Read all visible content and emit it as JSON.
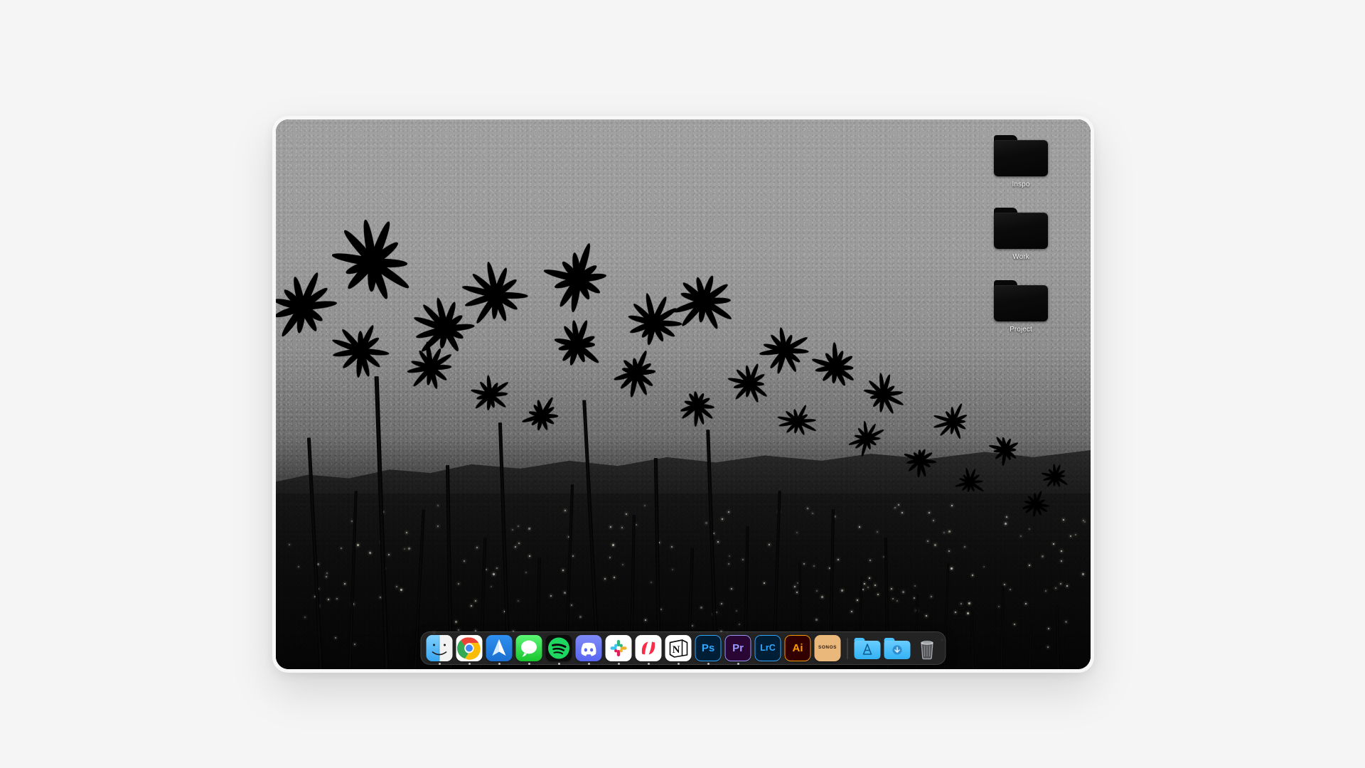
{
  "desktop": {
    "folders": [
      {
        "label": "Inspo",
        "icon": "folder-icon"
      },
      {
        "label": "Work",
        "icon": "folder-icon"
      },
      {
        "label": "Project",
        "icon": "folder-icon"
      }
    ]
  },
  "dock": {
    "items": [
      {
        "name": "finder",
        "label": "Finder",
        "icon": "finder-icon",
        "running": true
      },
      {
        "name": "chrome",
        "label": "Google Chrome",
        "icon": "chrome-icon",
        "running": true
      },
      {
        "name": "spark",
        "label": "Spark",
        "icon": "spark-mail-icon",
        "running": true
      },
      {
        "name": "messages",
        "label": "Messages",
        "icon": "messages-icon",
        "running": true
      },
      {
        "name": "spotify",
        "label": "Spotify",
        "icon": "spotify-icon",
        "running": true
      },
      {
        "name": "discord",
        "label": "Discord",
        "icon": "discord-icon",
        "running": true
      },
      {
        "name": "slack",
        "label": "Slack",
        "icon": "slack-icon",
        "running": true
      },
      {
        "name": "news",
        "label": "News",
        "icon": "apple-news-icon",
        "running": true
      },
      {
        "name": "notion",
        "label": "Notion",
        "icon": "notion-icon",
        "running": true
      },
      {
        "name": "photoshop",
        "label": "Adobe Photoshop",
        "icon": "photoshop-icon",
        "running": true,
        "badge": "Ps"
      },
      {
        "name": "premiere",
        "label": "Adobe Premiere Pro",
        "icon": "premiere-icon",
        "running": true,
        "badge": "Pr"
      },
      {
        "name": "lightroom",
        "label": "Lightroom Classic",
        "icon": "lightroom-icon",
        "running": false,
        "badge": "LrC"
      },
      {
        "name": "illustrator",
        "label": "Adobe Illustrator",
        "icon": "illustrator-icon",
        "running": false,
        "badge": "Ai"
      },
      {
        "name": "sonos",
        "label": "Sonos",
        "icon": "sonos-icon",
        "running": false,
        "badge": "SONOS"
      }
    ],
    "stacks": [
      {
        "name": "applications-folder",
        "label": "Applications",
        "icon": "applications-folder-icon"
      },
      {
        "name": "downloads-folder",
        "label": "Downloads",
        "icon": "downloads-folder-icon"
      }
    ],
    "trash": {
      "name": "trash",
      "label": "Trash",
      "icon": "trash-icon"
    }
  },
  "colors": {
    "page_background": "#f5f5f5",
    "device_bezel": "#f7f7f7",
    "dock_background": "#2a2a2c",
    "wallpaper_sky": "#9b9b9b",
    "folder_black": "#0b0b0b",
    "label_text": "#f2f2f2"
  }
}
